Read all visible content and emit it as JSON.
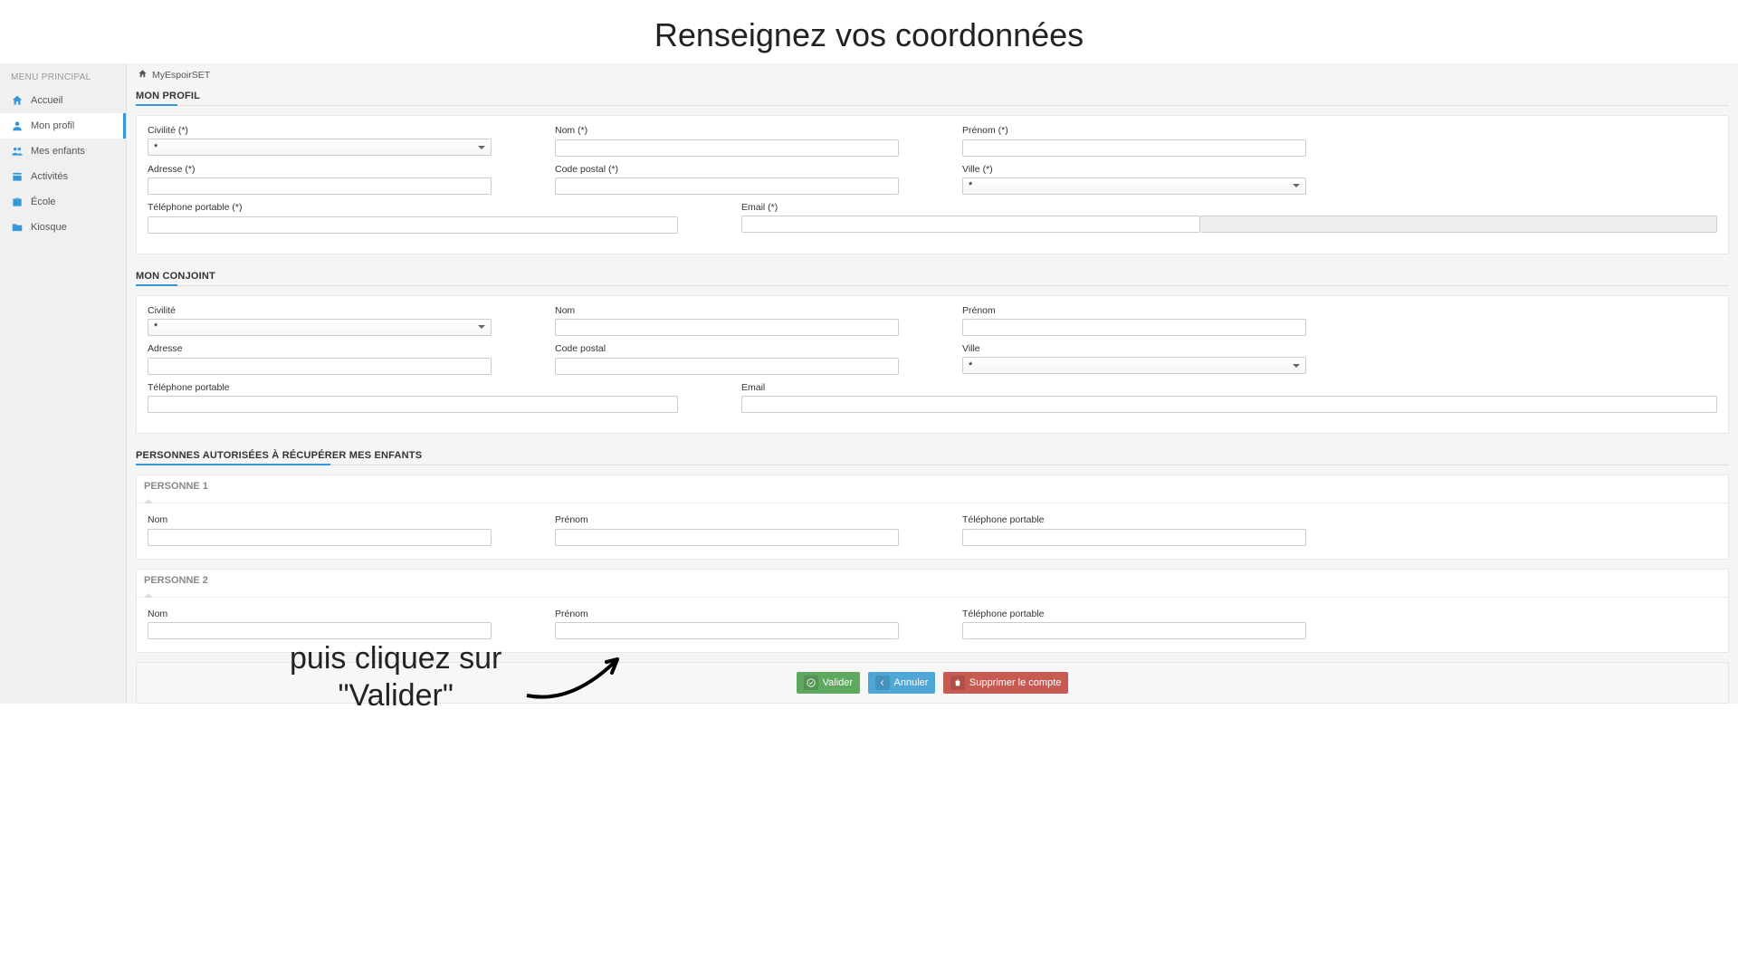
{
  "annotations": {
    "top": "Renseignez vos coordonnées",
    "bottom_line1": "puis cliquez sur",
    "bottom_line2": "\"Valider\""
  },
  "sidebar": {
    "header": "MENU PRINCIPAL",
    "items": [
      {
        "label": "Accueil"
      },
      {
        "label": "Mon profil"
      },
      {
        "label": "Mes enfants"
      },
      {
        "label": "Activités"
      },
      {
        "label": "École"
      },
      {
        "label": "Kiosque"
      }
    ]
  },
  "breadcrumb": {
    "text": "MyEspoirSET"
  },
  "sections": {
    "profile_title": "MON PROFIL",
    "spouse_title": "MON CONJOINT",
    "authorized_title": "PERSONNES AUTORISÉES À RÉCUPÉRER MES ENFANTS"
  },
  "labels": {
    "civilite_req": "Civilité (*)",
    "nom_req": "Nom (*)",
    "prenom_req": "Prénom (*)",
    "adresse_req": "Adresse (*)",
    "cp_req": "Code postal (*)",
    "ville_req": "Ville (*)",
    "tel_req": "Téléphone portable (*)",
    "email_req": "Email (*)",
    "civilite": "Civilité",
    "nom": "Nom",
    "prenom": "Prénom",
    "adresse": "Adresse",
    "cp": "Code postal",
    "ville": "Ville",
    "tel": "Téléphone portable",
    "email": "Email"
  },
  "select_placeholder": "*",
  "persons": {
    "p1": "PERSONNE 1",
    "p2": "PERSONNE 2"
  },
  "buttons": {
    "validate": "Valider",
    "cancel": "Annuler",
    "delete": "Supprimer le compte"
  }
}
